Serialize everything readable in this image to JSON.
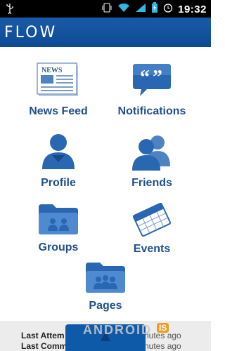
{
  "status_bar": {
    "time": "19:32",
    "icons": [
      "usb-icon",
      "vibrate-icon",
      "wifi-icon",
      "signal-icon",
      "battery-icon",
      "alarm-icon"
    ]
  },
  "app_bar": {
    "title": "FLOW"
  },
  "grid": [
    {
      "label": "News Feed",
      "icon": "newspaper-icon"
    },
    {
      "label": "Notifications",
      "icon": "speech-bubble-icon"
    },
    {
      "label": "Profile",
      "icon": "person-icon"
    },
    {
      "label": "Friends",
      "icon": "people-icon"
    },
    {
      "label": "Groups",
      "icon": "folder-icon"
    },
    {
      "label": "Events",
      "icon": "calendar-icon"
    },
    {
      "label": "Pages",
      "icon": "folder-people-icon"
    }
  ],
  "bottom": {
    "line1_label": "Last Attem",
    "line1_value": "nutes ago",
    "line2_label": "Last Comm",
    "line2_value": "nutes ago"
  },
  "watermark": {
    "text": "ANDROID",
    "badge": "IS"
  },
  "colors": {
    "accent": "#0f5aa8",
    "label": "#1f4f8c"
  }
}
